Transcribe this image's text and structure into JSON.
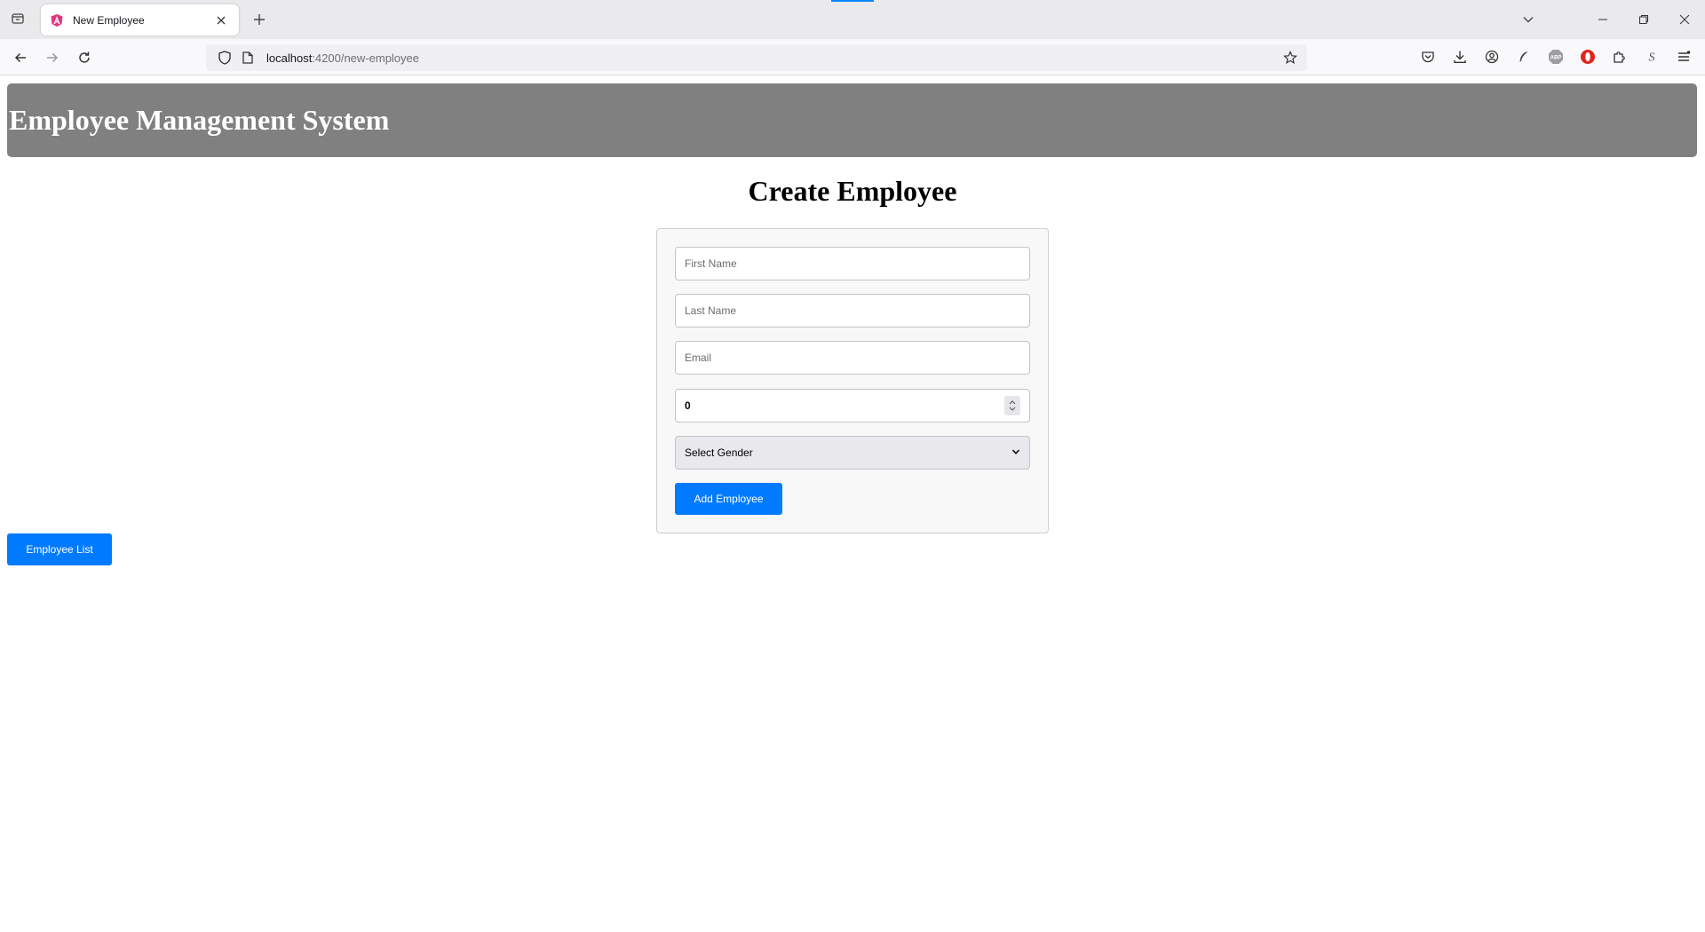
{
  "browser": {
    "tab_title": "New Employee",
    "url_host": "localhost",
    "url_path": ":4200/new-employee",
    "icons": {
      "tabs_menu": "firefox-view-icon",
      "favicon": "angular-icon",
      "close": "close-icon",
      "new_tab": "plus-icon",
      "list_tabs": "chevron-down-icon",
      "back": "back-arrow-icon",
      "forward": "forward-arrow-icon",
      "reload": "reload-icon",
      "shield": "shield-icon",
      "page": "page-icon",
      "star": "bookmark-star-icon",
      "extensions": [
        "pocket-icon",
        "download-icon",
        "account-icon",
        "feather-icon",
        "adblock-icon",
        "opera-icon",
        "extensions-puzzle-icon",
        "s-extension-icon",
        "menu-icon"
      ]
    },
    "accent_color": "#0a84ff"
  },
  "app": {
    "header_title": "Employee Management System",
    "header_bg": "#808080"
  },
  "form": {
    "heading": "Create Employee",
    "first_name_placeholder": "First Name",
    "last_name_placeholder": "Last Name",
    "email_placeholder": "Email",
    "age_value": "0",
    "gender_selected": "Select Gender",
    "submit_label": "Add Employee"
  },
  "nav": {
    "employee_list_label": "Employee List"
  },
  "colors": {
    "primary_button": "#007bff"
  }
}
